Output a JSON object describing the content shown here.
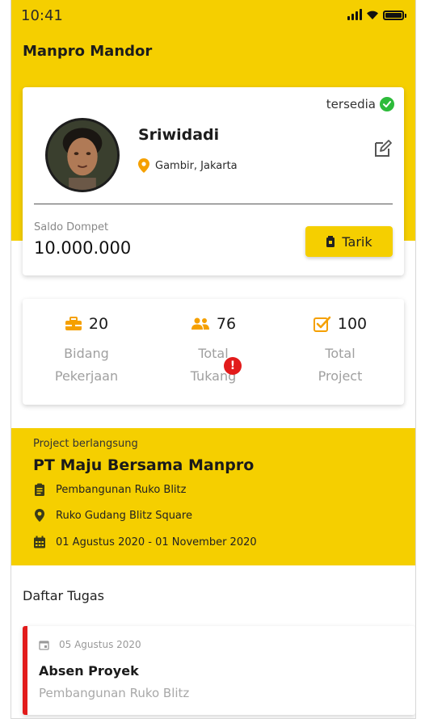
{
  "status_bar": {
    "time": "10:41"
  },
  "app": {
    "title": "Manpro Mandor"
  },
  "profile": {
    "availability": "tersedia",
    "name": "Sriwidadi",
    "location": "Gambir, Jakarta",
    "wallet_label": "Saldo Dompet",
    "wallet_value": "10.000.000",
    "withdraw_label": "Tarik"
  },
  "stats": [
    {
      "value": "20",
      "label_line1": "Bidang",
      "label_line2": "Pekerjaan",
      "icon": "toolbox-icon"
    },
    {
      "value": "76",
      "label_line1": "Total",
      "label_line2": "Tukang",
      "icon": "people-icon",
      "badge": "!"
    },
    {
      "value": "100",
      "label_line1": "Total",
      "label_line2": "Project",
      "icon": "checkbox-icon"
    }
  ],
  "project": {
    "label": "Project berlangsung",
    "name": "PT Maju Bersama Manpro",
    "building": "Pembangunan Ruko Blitz",
    "address": "Ruko Gudang Blitz Square",
    "period": "01 Agustus 2020 - 01 November 2020"
  },
  "tasks": {
    "title": "Daftar Tugas",
    "items": [
      {
        "date": "05 Agustus 2020",
        "title": "Absen Proyek",
        "subtitle": "Pembangunan Ruko Blitz"
      }
    ]
  },
  "colors": {
    "brand_yellow": "#f5cf00",
    "accent_orange": "#f5a000",
    "available_green": "#2dbb3a",
    "alert_red": "#e21b1b"
  }
}
